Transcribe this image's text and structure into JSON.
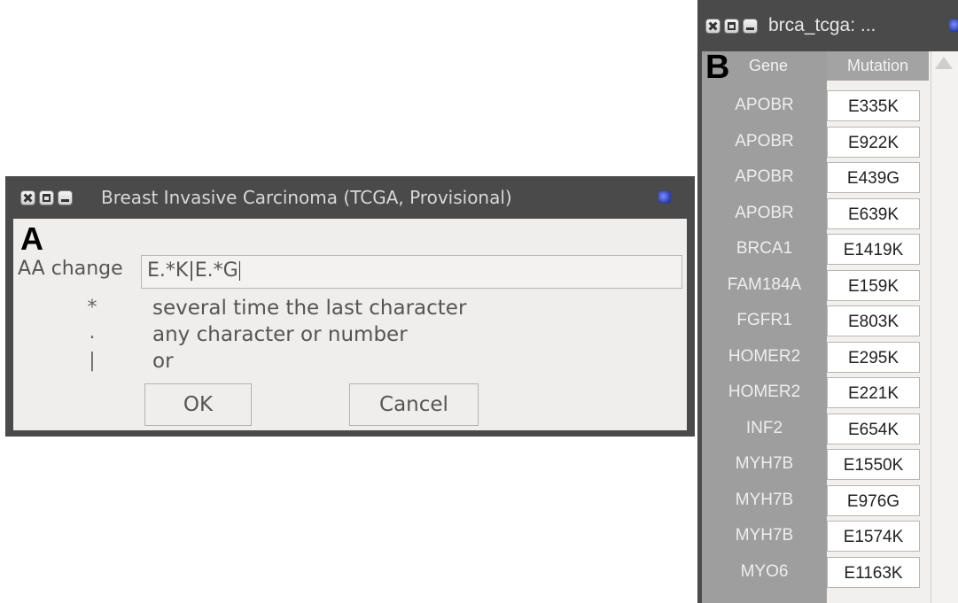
{
  "dialog_a": {
    "title": "Breast Invasive Carcinoma (TCGA, Provisional)",
    "panel_letter": "A",
    "aa_label": "AA change",
    "aa_value": "E.*K|E.*G",
    "legend": [
      {
        "symbol": "*",
        "text": "several time the last character"
      },
      {
        "symbol": ".",
        "text": "any character or number"
      },
      {
        "symbol": "|",
        "text": "or"
      }
    ],
    "ok_label": "OK",
    "cancel_label": "Cancel"
  },
  "window_b": {
    "title": "brca_tcga: ...",
    "panel_letter": "B",
    "columns": [
      "Gene",
      "Mutation"
    ],
    "rows": [
      {
        "gene": "APOBR",
        "mutation": "E335K"
      },
      {
        "gene": "APOBR",
        "mutation": "E922K"
      },
      {
        "gene": "APOBR",
        "mutation": "E439G"
      },
      {
        "gene": "APOBR",
        "mutation": "E639K"
      },
      {
        "gene": "BRCA1",
        "mutation": "E1419K"
      },
      {
        "gene": "FAM184A",
        "mutation": "E159K"
      },
      {
        "gene": "FGFR1",
        "mutation": "E803K"
      },
      {
        "gene": "HOMER2",
        "mutation": "E295K"
      },
      {
        "gene": "HOMER2",
        "mutation": "E221K"
      },
      {
        "gene": "INF2",
        "mutation": "E654K"
      },
      {
        "gene": "MYH7B",
        "mutation": "E1550K"
      },
      {
        "gene": "MYH7B",
        "mutation": "E976G"
      },
      {
        "gene": "MYH7B",
        "mutation": "E1574K"
      },
      {
        "gene": "MYO6",
        "mutation": "E1163K"
      }
    ]
  }
}
